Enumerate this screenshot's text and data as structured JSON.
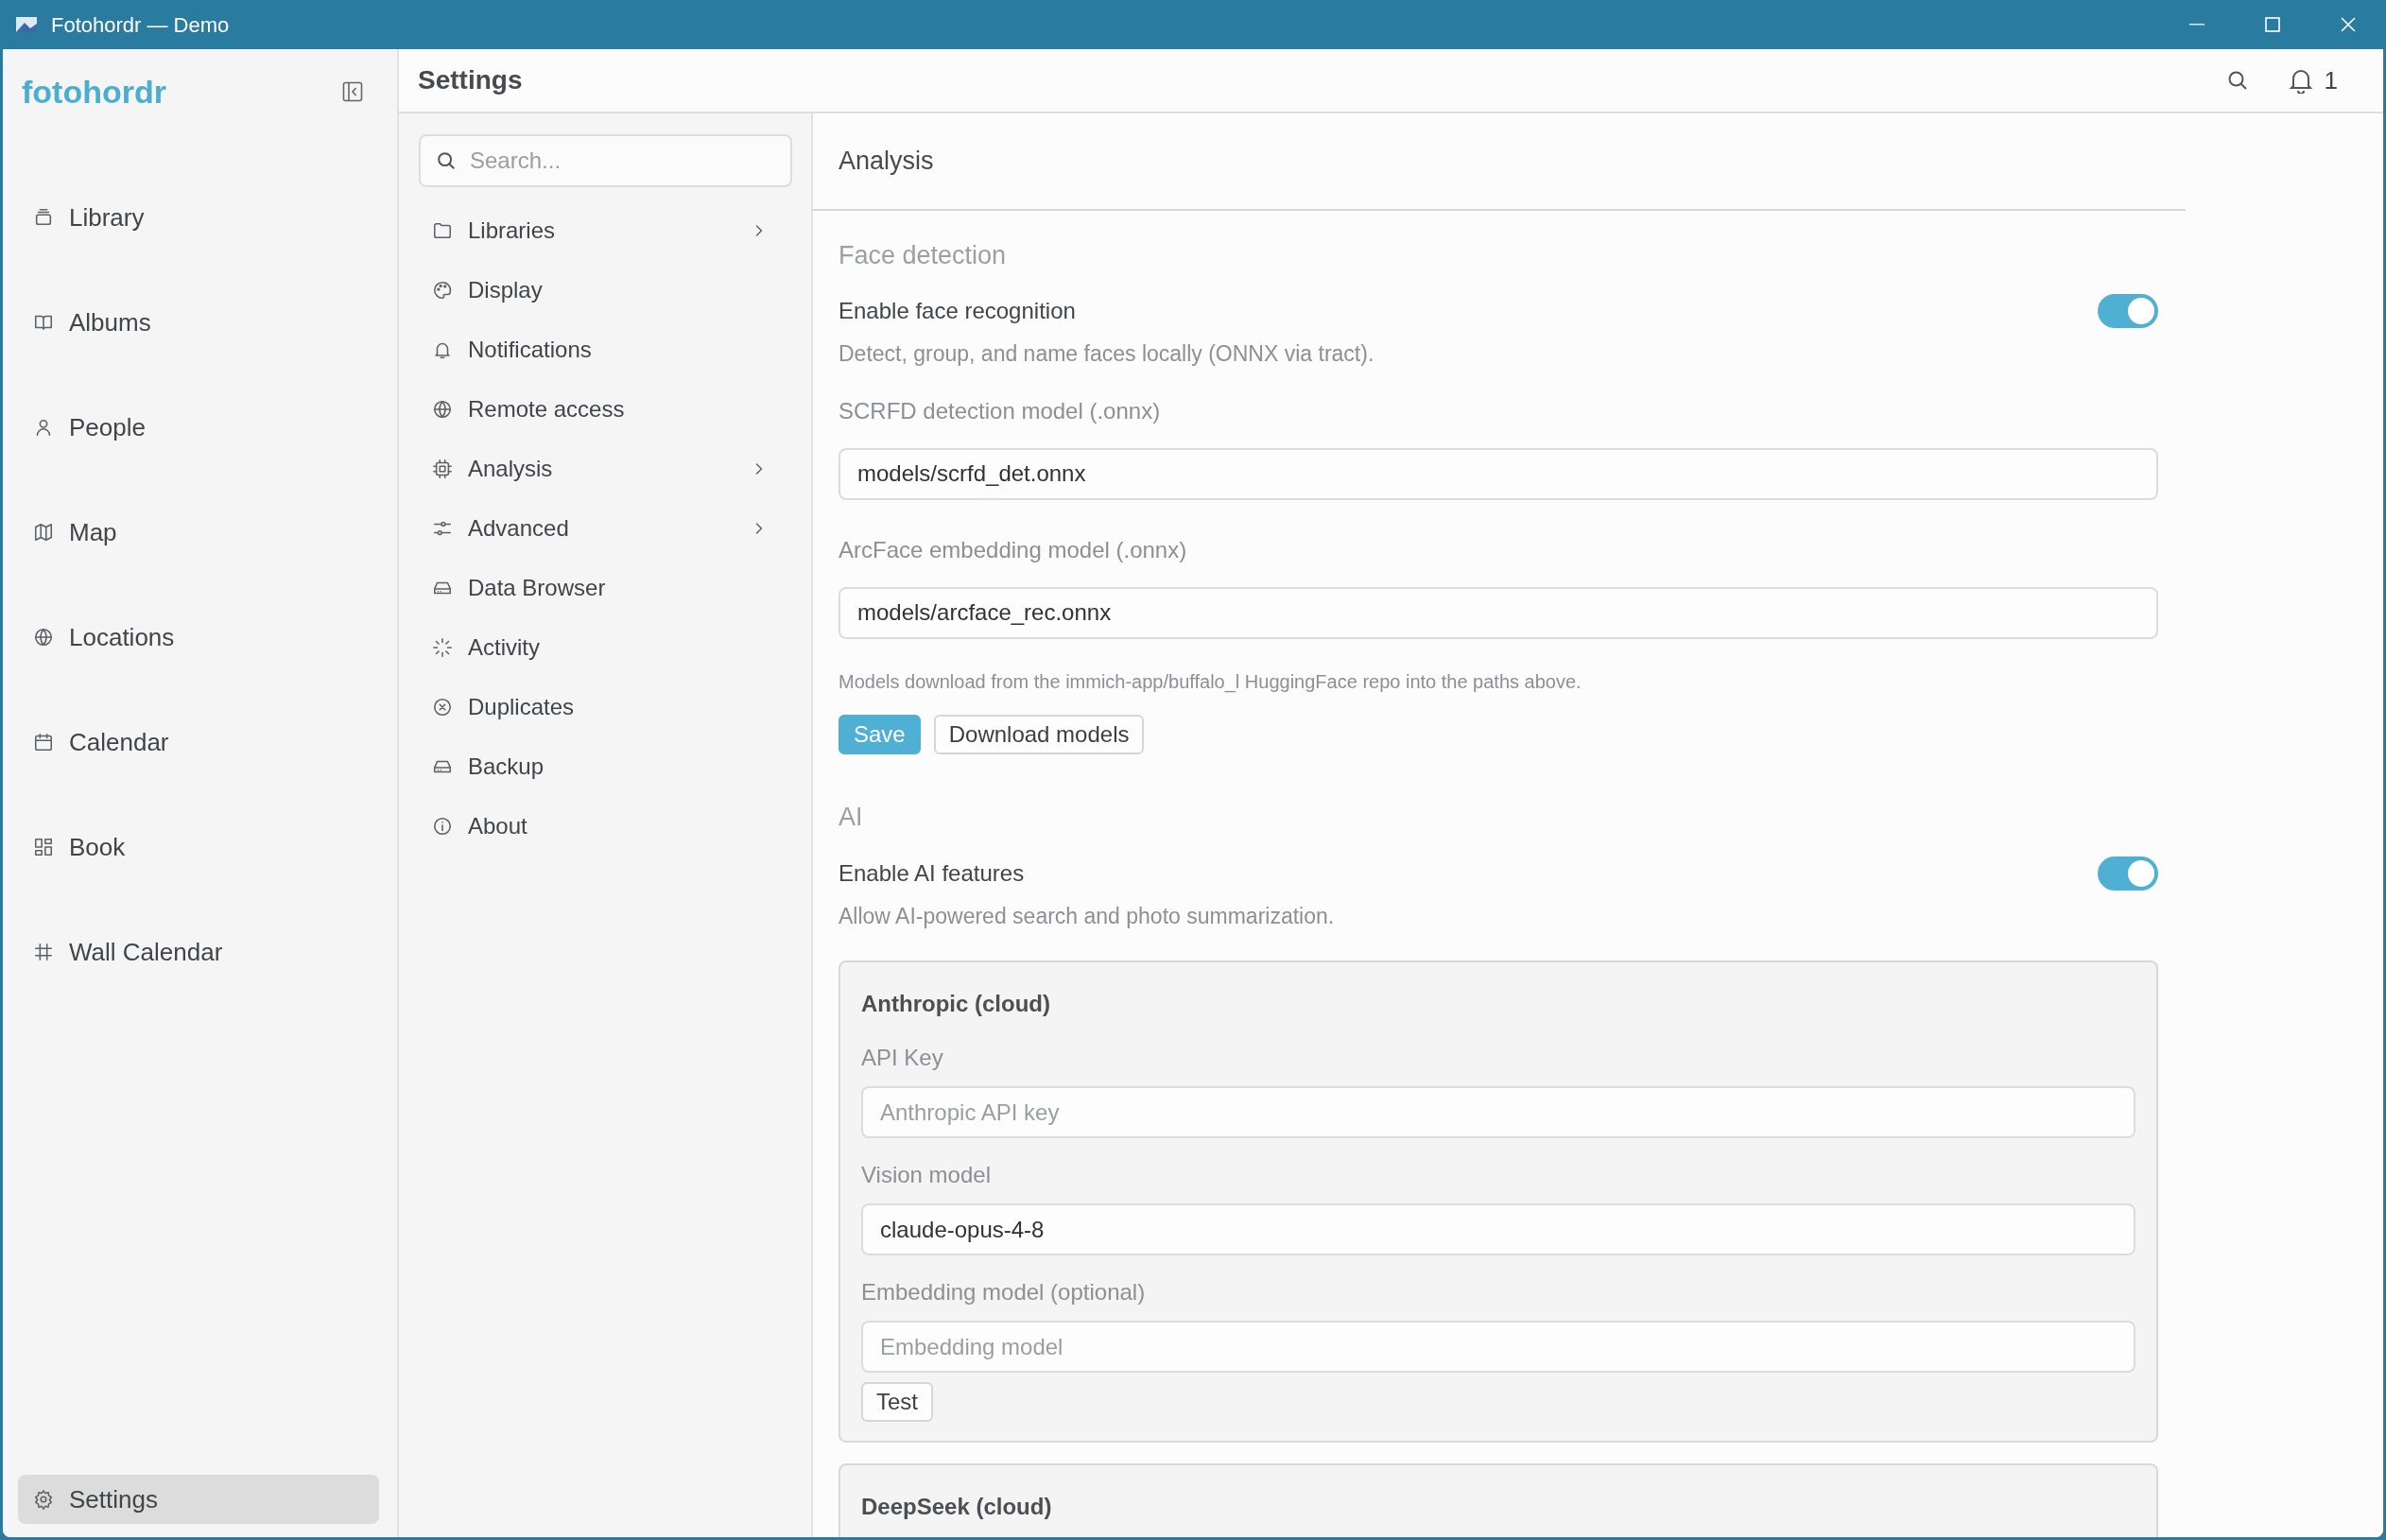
{
  "window": {
    "title": "Fotohordr — Demo"
  },
  "sidebar": {
    "logo": "fotohordr",
    "items": [
      {
        "label": "Library",
        "selected": false
      },
      {
        "label": "Albums",
        "selected": false
      },
      {
        "label": "People",
        "selected": false
      },
      {
        "label": "Map",
        "selected": false
      },
      {
        "label": "Locations",
        "selected": false
      },
      {
        "label": "Calendar",
        "selected": false
      },
      {
        "label": "Book",
        "selected": false
      },
      {
        "label": "Wall Calendar",
        "selected": false
      }
    ],
    "footer_item": {
      "label": "Settings",
      "selected": true
    }
  },
  "header": {
    "title": "Settings",
    "notification_count": "1"
  },
  "settings_nav": {
    "search": {
      "placeholder": "Search..."
    },
    "items": [
      {
        "label": "Libraries",
        "expandable": true
      },
      {
        "label": "Display",
        "expandable": false
      },
      {
        "label": "Notifications",
        "expandable": false
      },
      {
        "label": "Remote access",
        "expandable": false
      },
      {
        "label": "Analysis",
        "expandable": true
      },
      {
        "label": "Advanced",
        "expandable": true
      },
      {
        "label": "Data Browser",
        "expandable": false
      },
      {
        "label": "Activity",
        "expandable": false
      },
      {
        "label": "Duplicates",
        "expandable": false
      },
      {
        "label": "Backup",
        "expandable": false
      },
      {
        "label": "About",
        "expandable": false
      }
    ]
  },
  "content": {
    "title": "Analysis",
    "sections": [
      {
        "heading": "Face detection",
        "toggle": {
          "label": "Enable face recognition",
          "description": "Detect, group, and name faces locally (ONNX via tract).",
          "on": true
        },
        "fields": [
          {
            "label": "SCRFD detection model (.onnx)",
            "value": "models/scrfd_det.onnx"
          },
          {
            "label": "ArcFace embedding model (.onnx)",
            "value": "models/arcface_rec.onnx"
          }
        ],
        "note": "Models download from the immich-app/buffalo_l HuggingFace repo into the paths above.",
        "buttons": [
          {
            "label": "Save",
            "primary": true
          },
          {
            "label": "Download models",
            "primary": false
          }
        ]
      },
      {
        "heading": "AI",
        "toggle": {
          "label": "Enable AI features",
          "description": "Allow AI-powered search and photo summarization.",
          "on": true
        },
        "providers": [
          {
            "name": "Anthropic (cloud)",
            "fields": [
              {
                "label": "API Key",
                "placeholder": "Anthropic API key"
              },
              {
                "label": "Vision model",
                "value": "claude-opus-4-8"
              },
              {
                "label": "Embedding model (optional)",
                "placeholder": "Embedding model"
              }
            ],
            "buttons": [
              {
                "label": "Test",
                "primary": false
              }
            ]
          },
          {
            "name": "DeepSeek (cloud)"
          }
        ]
      }
    ]
  }
}
